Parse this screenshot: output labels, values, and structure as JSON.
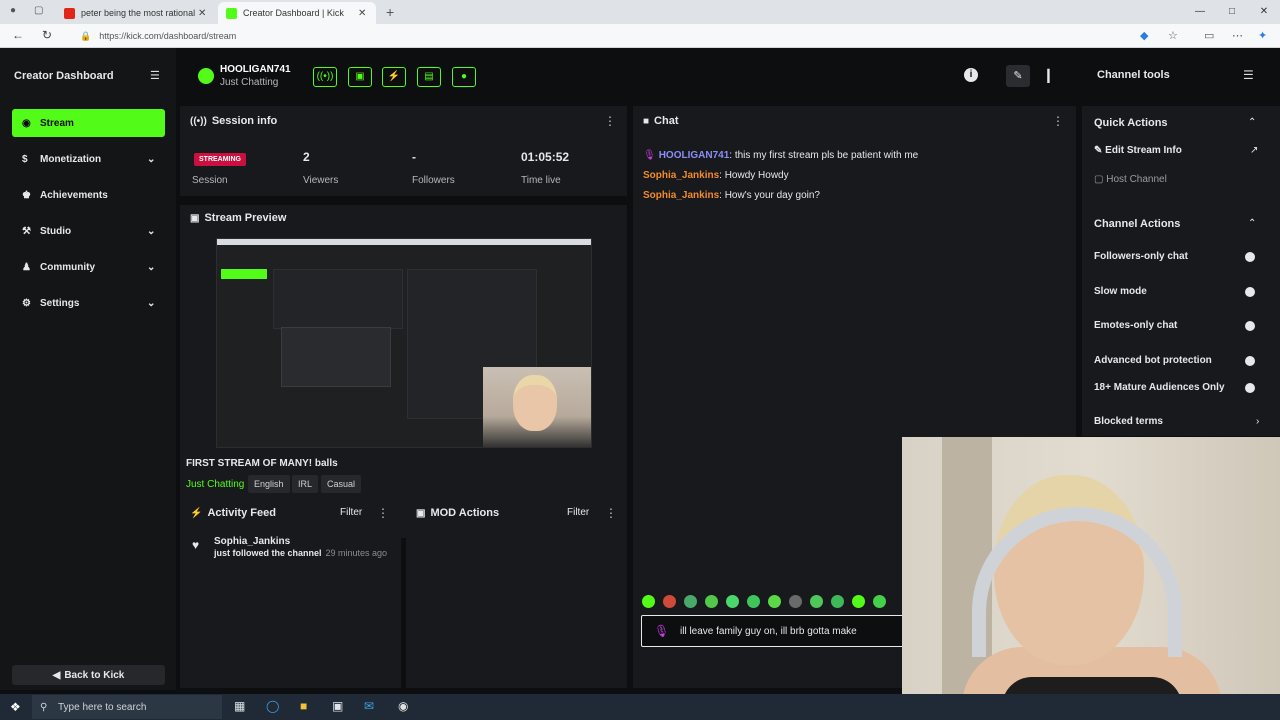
{
  "browser": {
    "tabs": [
      {
        "title": "peter being the most rational pe",
        "favicon_color": "#e1251b"
      },
      {
        "title": "Creator Dashboard | Kick",
        "favicon_color": "#53fc18"
      }
    ],
    "url": "https://kick.com/dashboard/stream"
  },
  "sidebar": {
    "title": "Creator Dashboard",
    "items": [
      {
        "label": "Stream",
        "icon": "broadcast-icon"
      },
      {
        "label": "Monetization",
        "icon": "dollar-icon"
      },
      {
        "label": "Achievements",
        "icon": "trophy-icon"
      },
      {
        "label": "Studio",
        "icon": "tool-icon"
      },
      {
        "label": "Community",
        "icon": "people-icon"
      },
      {
        "label": "Settings",
        "icon": "gear-icon"
      }
    ],
    "back_label": "Back to Kick"
  },
  "topbar": {
    "channel_name": "HOOLIGAN741",
    "category": "Just Chatting"
  },
  "session": {
    "title": "Session info",
    "status_badge": "STREAMING",
    "stats": [
      {
        "value": "",
        "label": "Session"
      },
      {
        "value": "2",
        "label": "Viewers"
      },
      {
        "value": "-",
        "label": "Followers"
      },
      {
        "value": "01:05:52",
        "label": "Time live"
      }
    ]
  },
  "preview": {
    "title": "Stream Preview",
    "stream_title": "FIRST STREAM OF MANY! balls",
    "category": "Just Chatting",
    "tags": [
      "English",
      "IRL",
      "Casual"
    ]
  },
  "activity": {
    "title": "Activity Feed",
    "filter_label": "Filter",
    "items": [
      {
        "user": "Sophia_Jankins",
        "text": "just followed the channel",
        "time": "29 minutes ago"
      }
    ]
  },
  "mod_actions": {
    "title": "MOD Actions",
    "filter_label": "Filter"
  },
  "chat": {
    "title": "Chat",
    "messages": [
      {
        "user": "HOOLIGAN741",
        "text": ": this my first stream pls be patient with me"
      },
      {
        "user": "Sophia_Jankins",
        "text": ": Howdy Howdy"
      },
      {
        "user": "Sophia_Jankins",
        "text": ": How's your day goin?"
      }
    ],
    "input_value": "ill leave family guy on, ill brb gotta make"
  },
  "channel_tools": {
    "title": "Channel tools",
    "quick_actions_title": "Quick Actions",
    "quick_actions": [
      "Edit Stream Info",
      "Host Channel"
    ],
    "channel_actions_title": "Channel Actions",
    "channel_actions": [
      "Followers-only chat",
      "Slow mode",
      "Emotes-only chat",
      "Advanced bot protection",
      "18+ Mature Audiences Only"
    ],
    "blocked_terms": "Blocked terms"
  },
  "taskbar": {
    "search_placeholder": "Type here to search"
  },
  "colors": {
    "accent": "#53fc18",
    "live": "#c9103f",
    "host_user": "#8b8ef5",
    "viewer_user": "#f28b2b"
  }
}
